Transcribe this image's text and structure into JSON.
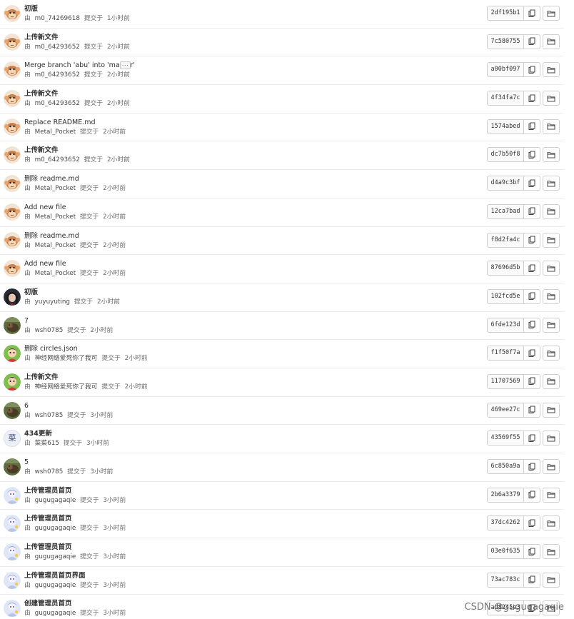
{
  "commits": [
    {
      "title": "初版",
      "title_bold": true,
      "avatar": "monkey-avatar",
      "author": "m0_74269618",
      "committed_label": "提交于",
      "time": "1小时前",
      "sha": "2df195b1"
    },
    {
      "title": "上传新文件",
      "title_bold": true,
      "avatar": "monkey-avatar",
      "author": "m0_64293652",
      "committed_label": "提交于",
      "time": "2小时前",
      "sha": "7c580755"
    },
    {
      "title": "Merge branch 'abu' into 'master'",
      "title_bold": false,
      "has_ellipsis": true,
      "avatar": "monkey-avatar",
      "author": "m0_64293652",
      "committed_label": "提交于",
      "time": "2小时前",
      "sha": "a00bf097"
    },
    {
      "title": "上传新文件",
      "title_bold": true,
      "avatar": "monkey-avatar",
      "author": "m0_64293652",
      "committed_label": "提交于",
      "time": "2小时前",
      "sha": "4f34fa7c"
    },
    {
      "title": "Replace README.md",
      "title_bold": false,
      "avatar": "monkey-avatar",
      "author": "Metal_Pocket",
      "committed_label": "提交于",
      "time": "2小时前",
      "sha": "1574abed"
    },
    {
      "title": "上传新文件",
      "title_bold": true,
      "avatar": "monkey-avatar",
      "author": "m0_64293652",
      "committed_label": "提交于",
      "time": "2小时前",
      "sha": "dc7b50f8"
    },
    {
      "title": "删除 readme.md",
      "title_bold": false,
      "avatar": "monkey-avatar",
      "author": "Metal_Pocket",
      "committed_label": "提交于",
      "time": "2小时前",
      "sha": "d4a9c3bf"
    },
    {
      "title": "Add new file",
      "title_bold": false,
      "avatar": "monkey-avatar",
      "author": "Metal_Pocket",
      "committed_label": "提交于",
      "time": "2小时前",
      "sha": "12ca7bad"
    },
    {
      "title": "删除 readme.md",
      "title_bold": false,
      "avatar": "monkey-avatar",
      "author": "Metal_Pocket",
      "committed_label": "提交于",
      "time": "2小时前",
      "sha": "f8d2fa4c"
    },
    {
      "title": "Add new file",
      "title_bold": false,
      "avatar": "monkey-avatar",
      "author": "Metal_Pocket",
      "committed_label": "提交于",
      "time": "2小时前",
      "sha": "87696d5b"
    },
    {
      "title": "初版",
      "title_bold": true,
      "avatar": "portrait-avatar",
      "author": "yuyuyuting",
      "committed_label": "提交于",
      "time": "2小时前",
      "sha": "102fcd5e"
    },
    {
      "title": "7",
      "title_bold": false,
      "avatar": "dog-avatar",
      "author": "wsh0785",
      "committed_label": "提交于",
      "time": "2小时前",
      "sha": "6fde123d"
    },
    {
      "title": "删除 circles.json",
      "title_bold": false,
      "avatar": "cartoon-avatar",
      "author": "神经网络爱死你了我可",
      "committed_label": "提交于",
      "time": "2小时前",
      "sha": "f1f50f7a"
    },
    {
      "title": "上传新文件",
      "title_bold": true,
      "avatar": "cartoon-avatar",
      "author": "神经网络爱死你了我可",
      "committed_label": "提交于",
      "time": "2小时前",
      "sha": "11707569"
    },
    {
      "title": "6",
      "title_bold": false,
      "avatar": "dog-avatar",
      "author": "wsh0785",
      "committed_label": "提交于",
      "time": "3小时前",
      "sha": "469ee27c"
    },
    {
      "title": "434更新",
      "title_bold": true,
      "avatar": "letter-avatar",
      "avatar_letter": "菜",
      "author": "菜菜615",
      "committed_label": "提交于",
      "time": "3小时前",
      "sha": "43569f55"
    },
    {
      "title": "5",
      "title_bold": false,
      "avatar": "dog-avatar",
      "author": "wsh0785",
      "committed_label": "提交于",
      "time": "3小时前",
      "sha": "6c850a9a"
    },
    {
      "title": "上传管理员首页",
      "title_bold": true,
      "avatar": "pastel-avatar",
      "author": "gugugagaqie",
      "committed_label": "提交于",
      "time": "3小时前",
      "sha": "2b6a3379"
    },
    {
      "title": "上传管理员首页",
      "title_bold": true,
      "avatar": "pastel-avatar",
      "author": "gugugagaqie",
      "committed_label": "提交于",
      "time": "3小时前",
      "sha": "37dc4262"
    },
    {
      "title": "上传管理员首页",
      "title_bold": true,
      "avatar": "pastel-avatar",
      "author": "gugugagaqie",
      "committed_label": "提交于",
      "time": "3小时前",
      "sha": "03e0f635"
    },
    {
      "title": "上传管理员首页界面",
      "title_bold": true,
      "avatar": "pastel-avatar",
      "author": "gugugagaqie",
      "committed_label": "提交于",
      "time": "3小时前",
      "sha": "73ac783c"
    },
    {
      "title": "创建管理员首页",
      "title_bold": true,
      "avatar": "pastel-avatar",
      "author": "gugugagaqie",
      "committed_label": "提交于",
      "time": "3小时前",
      "sha": "ad8245e3"
    }
  ],
  "by_label": "由",
  "ellipsis_label": "···",
  "icons": {
    "copy": "clipboard-icon",
    "browse": "folder-icon"
  },
  "colors": {
    "row_border": "#ececec",
    "sha_bg": "#fafafa",
    "button_border": "#cfcfcf"
  },
  "watermark": "CSDN @gugugagaqie"
}
